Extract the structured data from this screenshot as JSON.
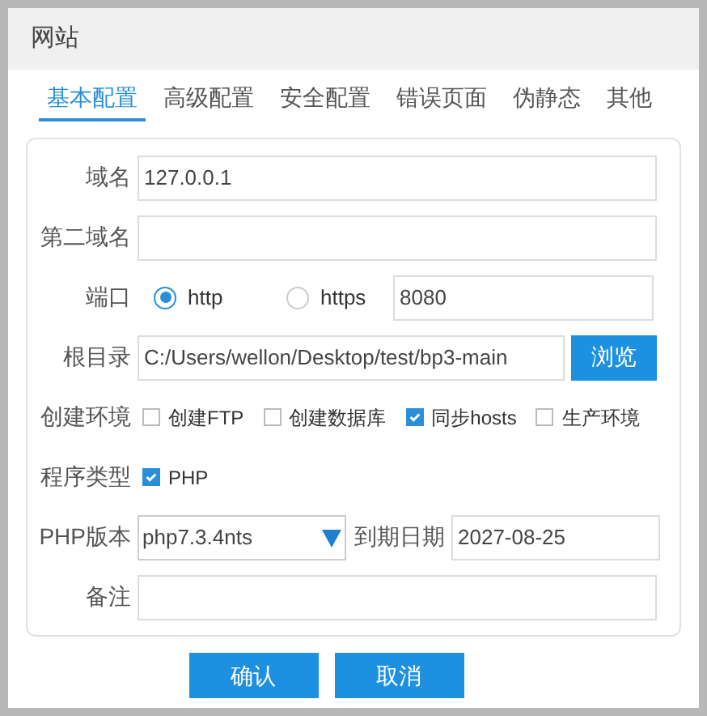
{
  "window": {
    "title": "网站"
  },
  "tabs": [
    {
      "label": "基本配置",
      "selected": true
    },
    {
      "label": "高级配置",
      "selected": false
    },
    {
      "label": "安全配置",
      "selected": false
    },
    {
      "label": "错误页面",
      "selected": false
    },
    {
      "label": "伪静态",
      "selected": false
    },
    {
      "label": "其他",
      "selected": false
    }
  ],
  "rows": [
    {
      "kind": "text",
      "label": "域名",
      "value": "127.0.0.1"
    },
    {
      "kind": "text",
      "label": "第二域名"
    },
    {
      "kind": "port",
      "label": "端口",
      "options": [
        {
          "label": "http",
          "selected": true
        },
        {
          "label": "https",
          "selected": false
        }
      ],
      "value": "8080"
    },
    {
      "kind": "path",
      "label": "根目录",
      "value": "C:/Users/wellon/Desktop/test/bp3-main",
      "button": "浏览"
    },
    {
      "kind": "checks",
      "label": "创建环境",
      "options": [
        {
          "label": "创建FTP",
          "checked": false
        },
        {
          "label": "创建数据库",
          "checked": false
        },
        {
          "label": "同步hosts",
          "checked": true
        },
        {
          "label": "生产环境",
          "checked": false
        }
      ]
    },
    {
      "kind": "checks",
      "label": "程序类型",
      "options": [
        {
          "label": "PHP",
          "checked": true
        }
      ]
    },
    {
      "kind": "version",
      "label": "PHP版本",
      "value": "php7.3.4nts",
      "date_label": "到期日期",
      "date": "2027-08-25"
    },
    {
      "kind": "text",
      "label": "备注"
    }
  ],
  "buttons": [
    "确认",
    "取消"
  ]
}
